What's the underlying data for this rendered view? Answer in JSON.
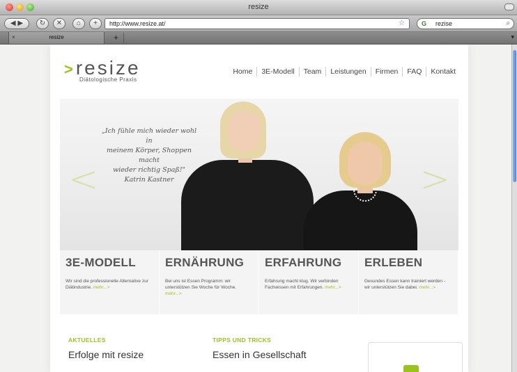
{
  "browser": {
    "window_title": "resize",
    "url": "http://www.resize.at/",
    "search_query": "rezise",
    "search_engine_icon": "G",
    "tab_label": "resize",
    "new_tab_label": "+",
    "icons": {
      "back": "◀",
      "forward": "▶",
      "reload": "↻",
      "stop": "✕",
      "home": "⌂",
      "add": "+",
      "bookmark": "☆",
      "search": "⌕",
      "tab_close": "×",
      "tab_menu": "▾"
    }
  },
  "site": {
    "logo": {
      "arrow": ">",
      "name": "resize",
      "tagline": "Diätologische Praxis"
    },
    "nav": [
      "Home",
      "3E-Modell",
      "Team",
      "Leistungen",
      "Firmen",
      "FAQ",
      "Kontakt"
    ],
    "hero": {
      "quote_line1": "„Ich fühle mich wieder wohl in",
      "quote_line2": "meinem Körper, Shoppen macht",
      "quote_line3": "wieder richtig Spaß!\"",
      "quote_author": "Katrin Kastner",
      "prev_glyph": "<",
      "next_glyph": ">"
    },
    "features": [
      {
        "title": "3E-MODELL",
        "text": "Wir sind die professionelle Alternative zur Diätindustrie.",
        "more": "mehr...>"
      },
      {
        "title": "ERNÄHRUNG",
        "text": "Bei uns ist Essen Programm: wir unterstützen Sie Woche für Woche.",
        "more": "mehr...>"
      },
      {
        "title": "ERFAHRUNG",
        "text": "Erfahrung macht klug. Wir verbinden Fachwissen mit Erfahrungen.",
        "more": "mehr...>"
      },
      {
        "title": "ERLEBEN",
        "text": "Gesundes Essen kann trainiert werden - wir unterstützen Sie dabei.",
        "more": "mehr...>"
      }
    ],
    "news": [
      {
        "label": "AKTUELLES",
        "title": "Erfolge mit resize"
      },
      {
        "label": "TIPPS UND TRICKS",
        "title": "Essen in Gesellschaft"
      }
    ],
    "colors": {
      "accent": "#9ac31c",
      "text": "#555555"
    }
  }
}
